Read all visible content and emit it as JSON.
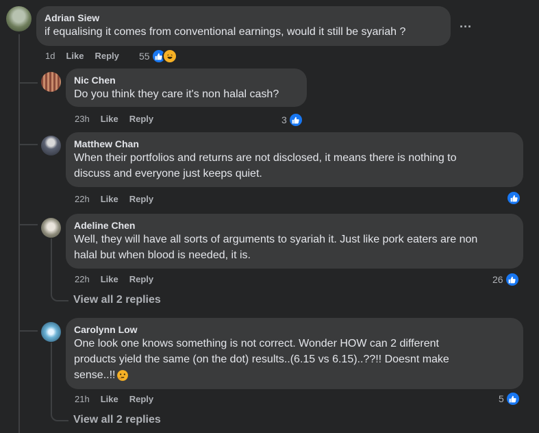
{
  "comment": {
    "author": "Adrian Siew",
    "text": "if equalising it comes from conventional earnings, would it still be syariah ?",
    "time": "1d",
    "like": "Like",
    "reply": "Reply",
    "reactions": "55",
    "more": "..."
  },
  "replies": [
    {
      "author": "Nic Chen",
      "lines": [
        "Do you think they care it's non halal cash?"
      ],
      "time": "23h",
      "like": "Like",
      "reply": "Reply",
      "reactions": "3"
    },
    {
      "author": "Matthew Chan",
      "lines": [
        "When their portfolios and returns are not disclosed, it means there is nothing to",
        "discuss and everyone just keeps quiet."
      ],
      "time": "22h",
      "like": "Like",
      "reply": "Reply",
      "reactions": ""
    },
    {
      "author": "Adeline Chen",
      "lines": [
        "Well, they will have all sorts of arguments to syariah it. Just like pork eaters are non",
        "halal but when blood is needed, it is."
      ],
      "time": "22h",
      "like": "Like",
      "reply": "Reply",
      "reactions": "26",
      "view_replies": "View all 2 replies"
    },
    {
      "author": "Carolynn Low",
      "lines": [
        "One look one knows something is not correct. Wonder HOW can 2 different",
        "products yield the same (on the dot) results..(6.15 vs 6.15)..??!! Doesnt make",
        "sense..!!"
      ],
      "time": "21h",
      "like": "Like",
      "reply": "Reply",
      "reactions": "5",
      "view_replies": "View all 2 replies"
    }
  ],
  "colors": {
    "like_blue": "#1877f2",
    "bubble": "#3a3b3c",
    "background": "#242526"
  }
}
